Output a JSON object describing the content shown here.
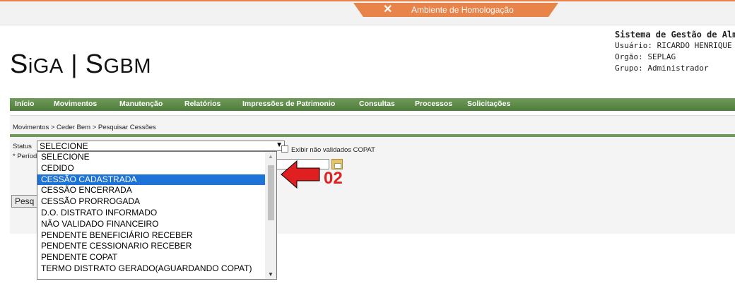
{
  "environment": {
    "label": "Ambiente de Homologação",
    "icon": "tools-icon"
  },
  "logo": {
    "text_a": "S",
    "text_b": "i",
    "text_c": "GA",
    "sep": "|",
    "text_d": "S",
    "text_e": "GBM"
  },
  "user_info": {
    "system": "Sistema de Gestão de Almo",
    "user": "Usuário: RICARDO HENRIQUE",
    "org": "Orgão: SEPLAG",
    "group": "Grupo: Administrador"
  },
  "nav": [
    "Início",
    "Movimentos",
    "Manutenção",
    "Relatórios",
    "Impressões de Patrimonio",
    "Consultas",
    "Processos",
    "Solicitações"
  ],
  "breadcrumb": "Movimentos  > Ceder Bem  > Pesquisar Cessões",
  "form": {
    "status_label": "Status",
    "periodo_label": "* Períod",
    "status_value": "SELECIONE",
    "checkbox_label": "Exibir não validados COPAT",
    "search_button": "Pesq"
  },
  "dropdown": {
    "options": [
      "SELECIONE",
      "CEDIDO",
      "CESSÃO CADASTRADA",
      "CESSÃO ENCERRADA",
      "CESSÃO PRORROGADA",
      "D.O. DISTRATO INFORMADO",
      "NÃO VALIDADO FINANCEIRO",
      "PENDENTE BENEFICIÁRIO RECEBER",
      "PENDENTE CESSIONARIO RECEBER",
      "PENDENTE COPAT",
      "TERMO DISTRATO GERADO(AGUARDANDO COPAT)"
    ],
    "selected_index": 2
  },
  "annotation": {
    "label": "02",
    "color": "#e02020"
  },
  "colors": {
    "nav": "#5b8a47",
    "accent": "#e8834a",
    "selection": "#1e73d8"
  }
}
